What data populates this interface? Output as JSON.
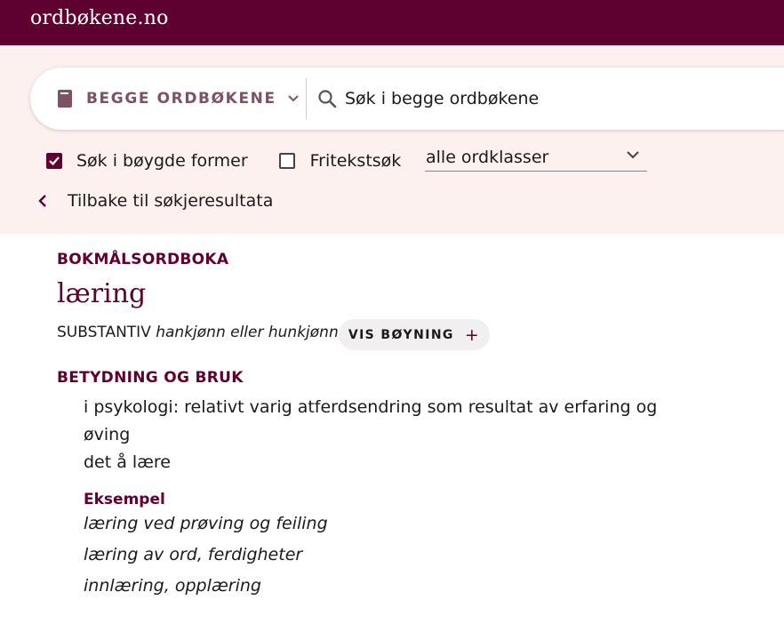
{
  "site": {
    "logo": "ordbøkene.no"
  },
  "search": {
    "dictionary_label": "BEGGE ORDBØKENE",
    "placeholder": "Søk i begge ordbøkene",
    "value": ""
  },
  "filters": {
    "inflected": {
      "label": "Søk i bøygde former",
      "checked": true
    },
    "fulltext": {
      "label": "Fritekstsøk",
      "checked": false
    },
    "word_class": {
      "selected": "alle ordklasser"
    }
  },
  "nav": {
    "back_label": "Tilbake til søkjeresultata"
  },
  "article": {
    "dictionary": "BOKMÅLSORDBOKA",
    "headword": "læring",
    "pos": "SUBSTANTIV",
    "gender": "hankjønn eller hunkjønn",
    "inflection_button": "VIS BØYNING",
    "section_heading": "BETYDNING OG BRUK",
    "definitions": [
      "i psykologi: relativt varig atferdsendring som resultat av erfaring og øving",
      "det å lære"
    ],
    "example_heading": "Eksempel",
    "examples": [
      "læring ved prøving og feiling",
      "læring av ord, ferdigheter",
      "innlæring, opplæring"
    ]
  },
  "icons": {
    "dictionary": "book-icon",
    "dropdown": "chevron-down-icon",
    "search": "search-icon",
    "back": "chevron-left-icon",
    "expand": "plus-icon"
  },
  "colors": {
    "brand": "#5e0030",
    "search_area_bg": "#fdf1f0",
    "dictionary_label": "#7d5166",
    "button_bg": "#f1efef"
  }
}
